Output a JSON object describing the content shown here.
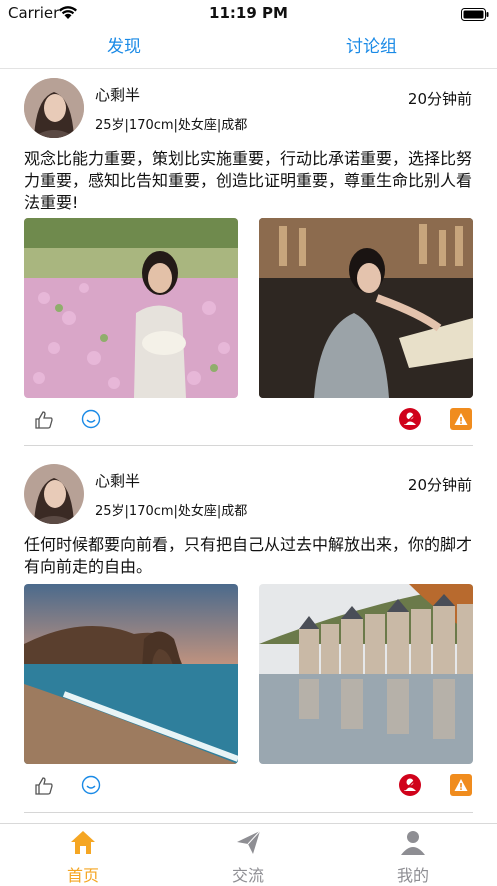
{
  "status_bar": {
    "carrier": "Carrier",
    "time": "11:19 PM"
  },
  "top_tabs": [
    {
      "label": "发现"
    },
    {
      "label": "讨论组"
    }
  ],
  "posts": [
    {
      "username": "心剩半",
      "info": "25岁|170cm|处女座|成都",
      "time": "20分钟前",
      "text": "观念比能力重要，策划比实施重要，行动比承诺重要，选择比努力重要，感知比告知重要，创造比证明重要，尊重生命比别人看法重要!"
    },
    {
      "username": "心剩半",
      "info": "25岁|170cm|处女座|成都",
      "time": "20分钟前",
      "text": "任何时候都要向前看，只有把自己从过去中解放出来，你的脚才有向前走的自由。"
    }
  ],
  "tab_bar": {
    "items": [
      {
        "label": "首页"
      },
      {
        "label": "交流"
      },
      {
        "label": "我的"
      }
    ]
  },
  "colors": {
    "accent": "#1a8ae6",
    "active_tab": "#f5a623",
    "inactive_tab": "#8e8e93",
    "report": "#d0021b",
    "warn": "#f08c1e"
  }
}
